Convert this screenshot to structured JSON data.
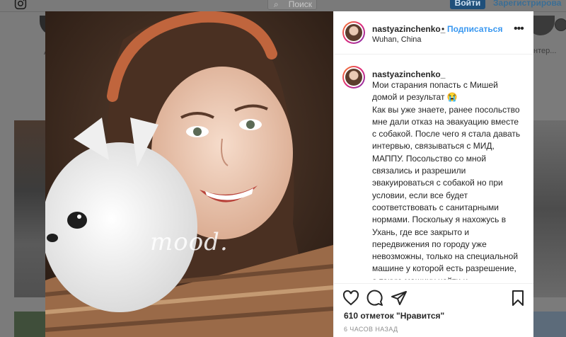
{
  "background": {
    "search_label": "Поиск",
    "login_label": "Войти",
    "signup_label": "Зарегистрирова",
    "left_caption": "A",
    "right_caption": "нтер..."
  },
  "post": {
    "username": "nastyazinchenko_",
    "separator": "•",
    "follow_label": "Подписаться",
    "location": "Wuhan, China",
    "more_label": "•••",
    "watermark": "mood.",
    "caption_username": "nastyazinchenko_",
    "caption_text": "Мои старания попасть с Мишей домой и результат 😭\nКак вы уже знаете, ранее посольство мне дали отказ на эвакуацию вместе с собакой. После чего я стала давать интервью, связываться с МИД, МАППУ. Посольство со мной связались и разрешили эвакуироваться с собакой но при условии, если все будет соответствовать с санитарными нормами. Поскольку я нахожусь в Ухань, где все закрыто и передвижения по городу уже невозможны, только на специальной машине у которой есть разрешение, а такую машину найти и забронировать поездку можно через правоохранительные органы",
    "likes": "610 отметок \"Нравится\"",
    "time": "6 ЧАСОВ НАЗАД"
  },
  "icons": {
    "like": "heart-icon",
    "comment": "comment-icon",
    "share": "share-icon",
    "save": "bookmark-icon"
  }
}
